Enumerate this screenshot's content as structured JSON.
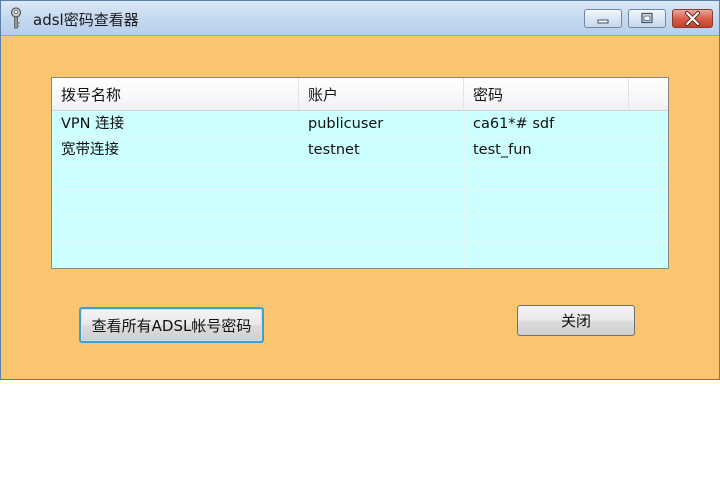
{
  "window": {
    "title": "adsl密码查看器",
    "icon": "key-icon",
    "caption_buttons": [
      "minimize-icon",
      "maximize-icon",
      "close-icon"
    ]
  },
  "listview": {
    "columns": [
      "拨号名称",
      "账户",
      "密码",
      ""
    ],
    "rows": [
      {
        "name": "VPN 连接",
        "account": "publicuser",
        "password": "ca61*# sdf"
      },
      {
        "name": "宽带连接",
        "account": "testnet",
        "password": "test_fun"
      }
    ],
    "background": "#ccffff"
  },
  "buttons": {
    "view_all": "查看所有ADSL帐号密码",
    "close": "关闭"
  },
  "colors": {
    "window_bg": "#f9c56e",
    "focus_border": "#3c9fd6"
  }
}
